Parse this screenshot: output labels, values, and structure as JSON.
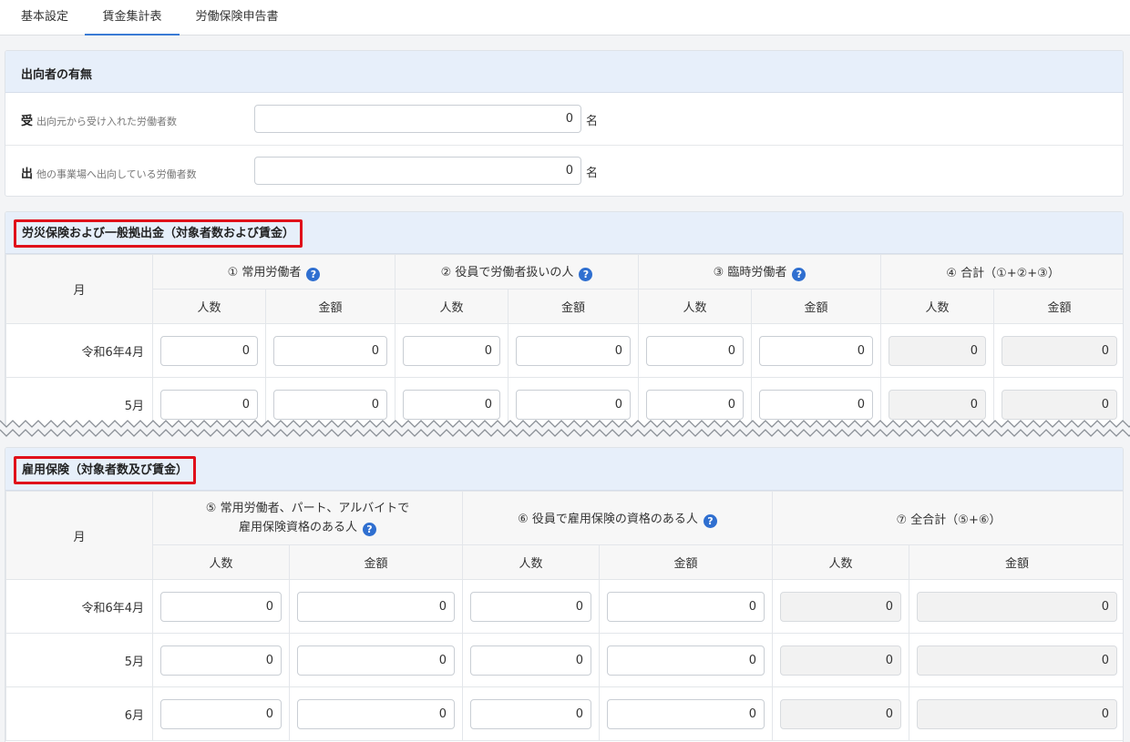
{
  "tabs": [
    "基本設定",
    "賃金集計表",
    "労働保険申告書"
  ],
  "secondment": {
    "title": "出向者の有無",
    "rows": [
      {
        "mark": "受",
        "label": "出向元から受け入れた労働者数",
        "value": "0",
        "unit": "名"
      },
      {
        "mark": "出",
        "label": "他の事業場へ出向している労働者数",
        "value": "0",
        "unit": "名"
      }
    ]
  },
  "rousai": {
    "title": "労災保険および一般拠出金（対象者数および賃金）",
    "month_header": "月",
    "groups": [
      "① 常用労働者",
      "② 役員で労働者扱いの人",
      "③ 臨時労働者",
      "④ 合計（①+②+③）"
    ],
    "sub_count": "人数",
    "sub_amount": "金額",
    "rows": [
      {
        "month": "令和6年4月",
        "values": [
          "0",
          "0",
          "0",
          "0",
          "0",
          "0",
          "0",
          "0"
        ]
      },
      {
        "month": "5月",
        "values": [
          "0",
          "0",
          "0",
          "0",
          "0",
          "0",
          "0",
          "0"
        ]
      }
    ]
  },
  "koyou": {
    "title": "雇用保険（対象者数及び賃金）",
    "month_header": "月",
    "group1_line1": "⑤ 常用労働者、パート、アルバイトで",
    "group1_line2": "雇用保険資格のある人",
    "group2": "⑥ 役員で雇用保険の資格のある人",
    "group3": "⑦ 全合計（⑤+⑥）",
    "sub_count": "人数",
    "sub_amount": "金額",
    "rows": [
      {
        "month": "令和6年4月",
        "values": [
          "0",
          "0",
          "0",
          "0",
          "0",
          "0"
        ]
      },
      {
        "month": "5月",
        "values": [
          "0",
          "0",
          "0",
          "0",
          "0",
          "0"
        ]
      },
      {
        "month": "6月",
        "values": [
          "0",
          "0",
          "0",
          "0",
          "0",
          "0"
        ]
      }
    ]
  },
  "colors": {
    "accent": "#3a7bd5",
    "highlight_border": "#e0101a",
    "help_icon": "#2f6fd0",
    "section_header": "#e7effa"
  },
  "icons": {
    "help": "question-circle-icon"
  }
}
